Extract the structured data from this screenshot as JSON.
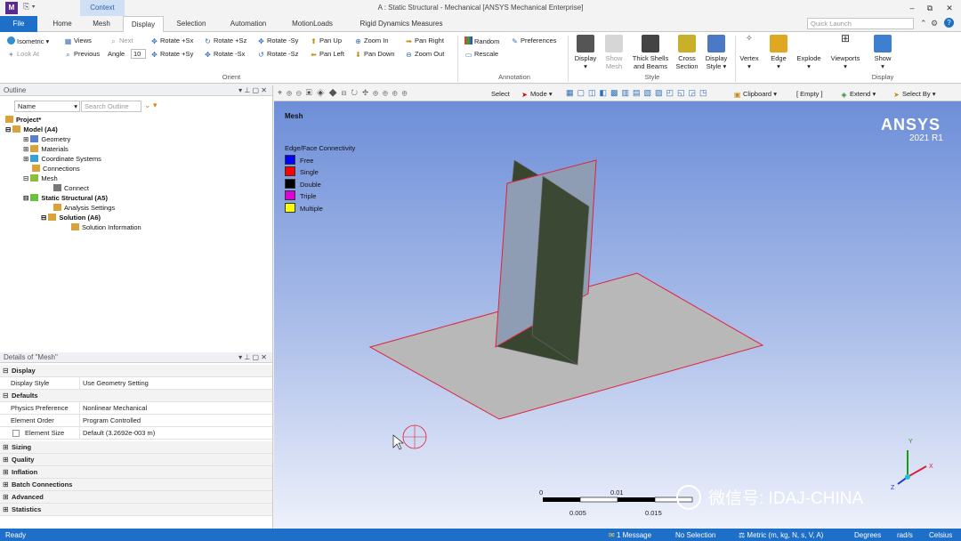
{
  "titlebar": {
    "context_tab": "Context",
    "title": "A : Static Structural - Mechanical [ANSYS Mechanical Enterprise]",
    "min": "–",
    "restore": "⧉",
    "close": "✕"
  },
  "menu": {
    "file": "File",
    "tabs": [
      "Home",
      "Mesh",
      "Display",
      "Selection",
      "Automation",
      "MotionLoads",
      "Rigid Dynamics Measures"
    ],
    "quick_launch": "Quick Launch"
  },
  "ribbon": {
    "orient": {
      "isometric": "Isometric",
      "views": "Views",
      "next": "Next",
      "look_at": "Look At",
      "previous": "Previous",
      "angle_label": "Angle",
      "angle_value": "10",
      "rotate_px": "Rotate +Sx",
      "rotate_pz": "Rotate +Sz",
      "rotate_my": "Rotate -Sy",
      "rotate_py": "Rotate +Sy",
      "rotate_mx": "Rotate -Sx",
      "rotate_mz": "Rotate -Sz",
      "pan_up": "Pan Up",
      "pan_left": "Pan Left",
      "pan_down": "Pan Down",
      "zoom_in": "Zoom In",
      "zoom_out": "Zoom Out",
      "pan_right": "Pan Right",
      "group": "Orient"
    },
    "annotation": {
      "random": "Random",
      "preferences": "Preferences",
      "rescale": "Rescale",
      "group": "Annotation"
    },
    "style": {
      "display": "Display",
      "show_mesh": "Show Mesh",
      "thick_shells": "Thick Shells and Beams",
      "cross_section": "Cross Section",
      "display_style": "Display Style",
      "group": "Style"
    },
    "other": {
      "vertex": "Vertex",
      "edge": "Edge",
      "explode": "Explode",
      "viewports": "Viewports",
      "show": "Show",
      "display_group": "Display"
    }
  },
  "outline": {
    "title": "Outline",
    "name_label": "Name",
    "search_placeholder": "Search Outline",
    "items": [
      "Project*",
      "Model (A4)",
      "Geometry",
      "Materials",
      "Coordinate Systems",
      "Connections",
      "Mesh",
      "Connect",
      "Static Structural (A5)",
      "Analysis Settings",
      "Solution (A6)",
      "Solution Information"
    ]
  },
  "details": {
    "title": "Details of \"Mesh\"",
    "display_section": "Display",
    "display_style_k": "Display Style",
    "display_style_v": "Use Geometry Setting",
    "defaults_section": "Defaults",
    "physics_k": "Physics Preference",
    "physics_v": "Nonlinear Mechanical",
    "order_k": "Element Order",
    "order_v": "Program Controlled",
    "size_k": "Element Size",
    "size_v": "Default (3.2692e-003 m)",
    "sections": [
      "Sizing",
      "Quality",
      "Inflation",
      "Batch Connections",
      "Advanced",
      "Statistics"
    ]
  },
  "viewtoolbar": {
    "select": "Select",
    "mode": "Mode",
    "clipboard": "Clipboard",
    "empty": "[ Empty ]",
    "extend": "Extend",
    "select_by": "Select By"
  },
  "viewport": {
    "label": "Mesh",
    "legend_title": "Edge/Face Connectivity",
    "legend": [
      {
        "label": "Free",
        "color": "#0000ff"
      },
      {
        "label": "Single",
        "color": "#ff0000"
      },
      {
        "label": "Double",
        "color": "#000000"
      },
      {
        "label": "Triple",
        "color": "#dd00dd"
      },
      {
        "label": "Multiple",
        "color": "#ffff00"
      }
    ],
    "brand": "ANSYS",
    "version": "2021 R1",
    "scale": {
      "zero": "0",
      "mid": "0.01",
      "q1": "0.005",
      "q3": "0.015"
    },
    "watermark": "微信号: IDAJ-CHINA"
  },
  "status": {
    "ready": "Ready",
    "messages": "1 Message",
    "selection": "No Selection",
    "units": "Metric (m, kg, N, s, V, A)",
    "degrees": "Degrees",
    "rads": "rad/s",
    "temp": "Celsius"
  }
}
